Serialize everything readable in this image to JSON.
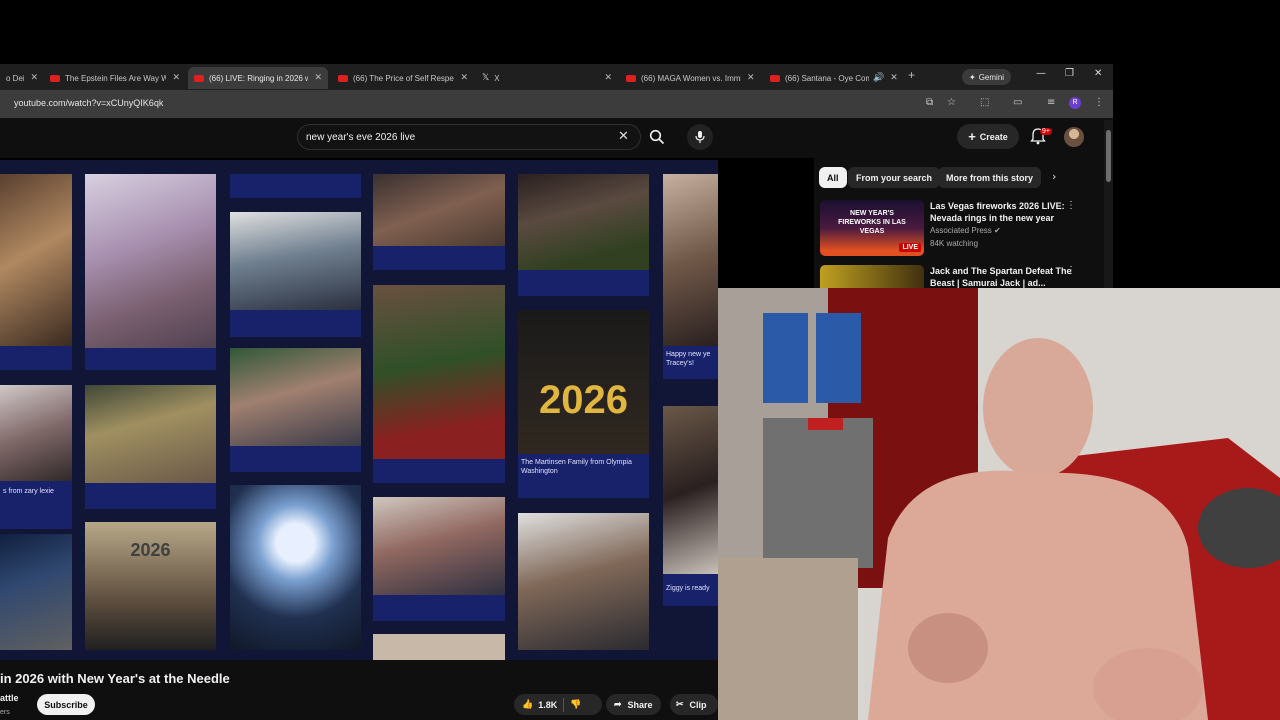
{
  "browser": {
    "tabs": [
      {
        "title": "o Dei"
      },
      {
        "title": "The Epstein Files Are Way Wo"
      },
      {
        "title": "(66) LIVE: Ringing in 2026 wi"
      },
      {
        "title": "(66) The Price of Self Respect"
      },
      {
        "title": "X"
      },
      {
        "title": "(66) MAGA Women vs. Immi"
      },
      {
        "title": "(66) Santana - Oye Como"
      }
    ],
    "gemini_label": "Gemini",
    "url": "youtube.com/watch?v=xCUnyQIK6qk"
  },
  "youtube": {
    "search_value": "new year's eve 2026 live",
    "create_label": "Create",
    "notification_count": "9+",
    "chips": [
      "All",
      "From your search",
      "More from this story"
    ],
    "recommendations": [
      {
        "title": "Las Vegas fireworks 2026 LIVE: Nevada rings in the new year",
        "channel": "Associated Press",
        "views": "84K watching",
        "thumb_text": "NEW YEAR'S FIREWORKS IN LAS VEGAS",
        "live_label": "LIVE"
      },
      {
        "title": "Jack and The Spartan Defeat The Beast | Samurai Jack | ad..."
      }
    ],
    "video": {
      "title": "in 2026 with New Year's at the Needle",
      "channel": "attle",
      "subs": "ers",
      "subscribe_label": "Subscribe",
      "likes": "1.8K",
      "share_label": "Share",
      "clip_label": "Clip"
    },
    "collage_captions": {
      "happy": "Happy new ye Tracey's!",
      "martinsen": "The Martinsen Family from Olympia Washington",
      "zary": "s from zary lexie",
      "ziggy": "Ziggy is ready",
      "sign_2026": "2026",
      "balloon_2026": "2026"
    }
  }
}
